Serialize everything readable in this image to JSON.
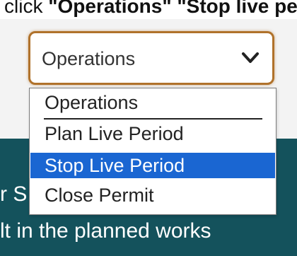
{
  "instruction": {
    "prefix": "click ",
    "bold_text": "\"Operations\" \"Stop live pe"
  },
  "background": {
    "line1": "r S",
    "line2": "lt in the planned works"
  },
  "select": {
    "value": "Operations",
    "icon": "chevron-down-icon",
    "border_color": "#b0722b"
  },
  "dropdown": {
    "options": [
      {
        "label": "Operations",
        "selected": false
      },
      {
        "label": "Plan Live Period",
        "selected": false
      },
      {
        "label": "Stop Live Period",
        "selected": true
      },
      {
        "label": "Close Permit",
        "selected": false
      }
    ],
    "highlight_color": "#1a66d2"
  },
  "colors": {
    "teal_panel": "#14525c"
  }
}
